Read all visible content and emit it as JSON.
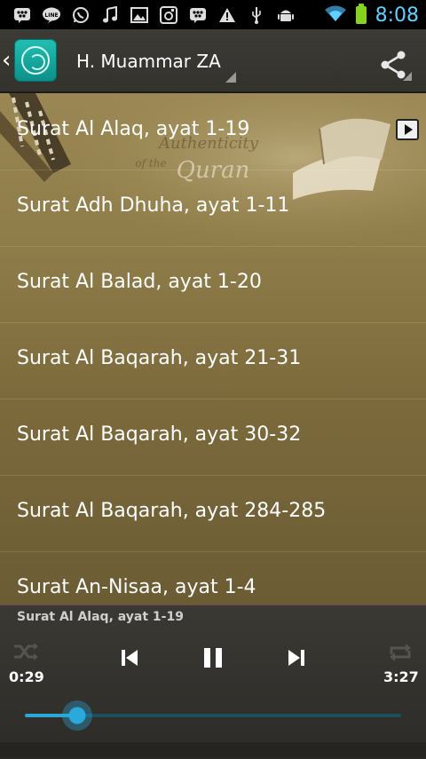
{
  "status_bar": {
    "icons": [
      "bbm-icon",
      "line-icon",
      "whatsapp-icon",
      "music-note-icon",
      "image-icon",
      "instagram-icon",
      "bbm-icon",
      "warning-icon",
      "usb-icon",
      "android-debug-icon"
    ],
    "time": "8:08"
  },
  "action_bar": {
    "title": "H. Muammar ZA"
  },
  "playlist": [
    {
      "label": "Surat Al Alaq, ayat 1-19",
      "playing": true
    },
    {
      "label": "Surat Adh Dhuha, ayat 1-11",
      "playing": false
    },
    {
      "label": "Surat Al Balad, ayat 1-20",
      "playing": false
    },
    {
      "label": "Surat Al Baqarah, ayat 21-31",
      "playing": false
    },
    {
      "label": "Surat Al Baqarah, ayat 30-32",
      "playing": false
    },
    {
      "label": "Surat Al Baqarah, ayat 284-285",
      "playing": false
    },
    {
      "label": "Surat An-Nisaa, ayat 1-4",
      "playing": false
    }
  ],
  "background_text": {
    "line1": "Authenticity",
    "line2": "of the",
    "line3": "Quran"
  },
  "player": {
    "now_playing": "Surat Al Alaq, ayat 1-19",
    "elapsed": "0:29",
    "duration": "3:27",
    "progress": 0.14,
    "state": "playing"
  },
  "colors": {
    "accent": "#2aa7d6",
    "clock": "#5fd0ff",
    "battery": "#86d51c"
  }
}
